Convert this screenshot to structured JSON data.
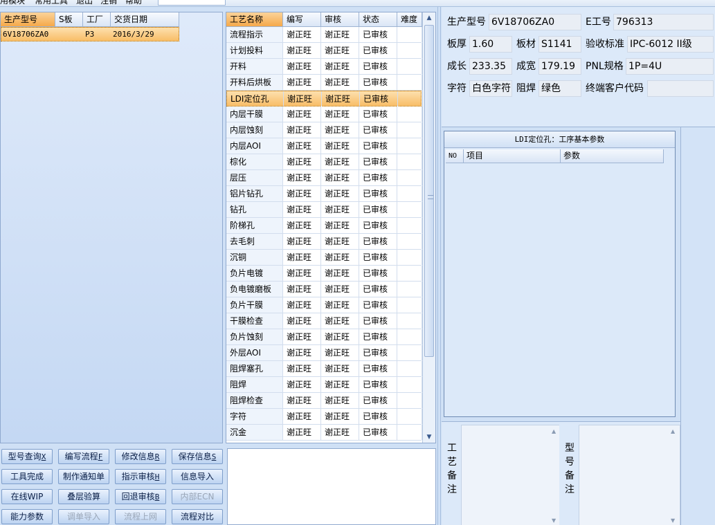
{
  "menu": [
    "用模块",
    "常用工具",
    "退出",
    "注销",
    "帮助"
  ],
  "left_grid": {
    "headers": [
      "生产型号",
      "S板",
      "工厂",
      "交货日期"
    ],
    "rows": [
      {
        "model": "6V18706ZA0",
        "s_board": "",
        "factory": "P3",
        "delivery": "2016/3/29"
      }
    ]
  },
  "process_grid": {
    "headers": [
      "工艺名称",
      "编写",
      "审核",
      "状态",
      "难度"
    ],
    "selected_index": 4,
    "rows": [
      {
        "name": "流程指示",
        "writer": "谢正旺",
        "auditor": "谢正旺",
        "status": "已审核"
      },
      {
        "name": "计划投料",
        "writer": "谢正旺",
        "auditor": "谢正旺",
        "status": "已审核"
      },
      {
        "name": "开料",
        "writer": "谢正旺",
        "auditor": "谢正旺",
        "status": "已审核"
      },
      {
        "name": "开料后烘板",
        "writer": "谢正旺",
        "auditor": "谢正旺",
        "status": "已审核"
      },
      {
        "name": "LDI定位孔",
        "writer": "谢正旺",
        "auditor": "谢正旺",
        "status": "已审核"
      },
      {
        "name": "内层干膜",
        "writer": "谢正旺",
        "auditor": "谢正旺",
        "status": "已审核"
      },
      {
        "name": "内层蚀刻",
        "writer": "谢正旺",
        "auditor": "谢正旺",
        "status": "已审核"
      },
      {
        "name": "内层AOI",
        "writer": "谢正旺",
        "auditor": "谢正旺",
        "status": "已审核"
      },
      {
        "name": "棕化",
        "writer": "谢正旺",
        "auditor": "谢正旺",
        "status": "已审核"
      },
      {
        "name": "层压",
        "writer": "谢正旺",
        "auditor": "谢正旺",
        "status": "已审核"
      },
      {
        "name": "铝片钻孔",
        "writer": "谢正旺",
        "auditor": "谢正旺",
        "status": "已审核"
      },
      {
        "name": "钻孔",
        "writer": "谢正旺",
        "auditor": "谢正旺",
        "status": "已审核"
      },
      {
        "name": "阶梯孔",
        "writer": "谢正旺",
        "auditor": "谢正旺",
        "status": "已审核"
      },
      {
        "name": "去毛刺",
        "writer": "谢正旺",
        "auditor": "谢正旺",
        "status": "已审核"
      },
      {
        "name": "沉铜",
        "writer": "谢正旺",
        "auditor": "谢正旺",
        "status": "已审核"
      },
      {
        "name": "负片电镀",
        "writer": "谢正旺",
        "auditor": "谢正旺",
        "status": "已审核"
      },
      {
        "name": "负电镀磨板",
        "writer": "谢正旺",
        "auditor": "谢正旺",
        "status": "已审核"
      },
      {
        "name": "负片干膜",
        "writer": "谢正旺",
        "auditor": "谢正旺",
        "status": "已审核"
      },
      {
        "name": "干膜检查",
        "writer": "谢正旺",
        "auditor": "谢正旺",
        "status": "已审核"
      },
      {
        "name": "负片蚀刻",
        "writer": "谢正旺",
        "auditor": "谢正旺",
        "status": "已审核"
      },
      {
        "name": "外层AOI",
        "writer": "谢正旺",
        "auditor": "谢正旺",
        "status": "已审核"
      },
      {
        "name": "阻焊塞孔",
        "writer": "谢正旺",
        "auditor": "谢正旺",
        "status": "已审核"
      },
      {
        "name": "阻焊",
        "writer": "谢正旺",
        "auditor": "谢正旺",
        "status": "已审核"
      },
      {
        "name": "阻焊检查",
        "writer": "谢正旺",
        "auditor": "谢正旺",
        "status": "已审核"
      },
      {
        "name": "字符",
        "writer": "谢正旺",
        "auditor": "谢正旺",
        "status": "已审核"
      },
      {
        "name": "沉金",
        "writer": "谢正旺",
        "auditor": "谢正旺",
        "status": "已审核"
      }
    ]
  },
  "buttons": [
    {
      "label": "型号查询",
      "key": "X",
      "enabled": true,
      "name": "model-query-button"
    },
    {
      "label": "编写流程",
      "key": "F",
      "enabled": true,
      "name": "write-flow-button"
    },
    {
      "label": "修改信息",
      "key": "R",
      "enabled": true,
      "name": "edit-info-button"
    },
    {
      "label": "保存信息",
      "key": "S",
      "enabled": true,
      "name": "save-info-button"
    },
    {
      "label": "工具完成",
      "key": "",
      "enabled": true,
      "name": "tool-complete-button"
    },
    {
      "label": "制作通知单",
      "key": "",
      "enabled": true,
      "name": "make-notice-button"
    },
    {
      "label": "指示审核",
      "key": "H",
      "enabled": true,
      "name": "instruction-audit-button"
    },
    {
      "label": "信息导入",
      "key": "",
      "enabled": true,
      "name": "info-import-button"
    },
    {
      "label": "在线WIP",
      "key": "",
      "enabled": true,
      "name": "online-wip-button"
    },
    {
      "label": "叠层验算",
      "key": "",
      "enabled": true,
      "name": "stackup-check-button"
    },
    {
      "label": "回退审核",
      "key": "B",
      "enabled": true,
      "name": "rollback-audit-button"
    },
    {
      "label": "内部ECN",
      "key": "",
      "enabled": false,
      "name": "internal-ecn-button"
    },
    {
      "label": "能力参数",
      "key": "",
      "enabled": true,
      "name": "capability-params-button"
    },
    {
      "label": "调单导入",
      "key": "",
      "enabled": false,
      "name": "order-import-button"
    },
    {
      "label": "流程上网",
      "key": "",
      "enabled": false,
      "name": "flow-online-button"
    },
    {
      "label": "流程对比",
      "key": "",
      "enabled": true,
      "name": "flow-compare-button"
    }
  ],
  "info": {
    "model_label": "生产型号",
    "model_value": "6V18706ZA0",
    "eno_label": "E工号",
    "eno_value": "796313",
    "thickness_label": "板厚",
    "thickness_value": "1.60",
    "material_label": "板材",
    "material_value": "S1141",
    "standard_label": "验收标准",
    "standard_value": "IPC-6012 II级",
    "length_label": "成长",
    "length_value": "233.35",
    "width_label": "成宽",
    "width_value": "179.19",
    "pnl_label": "PNL规格",
    "pnl_value": "1P=4U",
    "char_label": "字符",
    "char_value": "白色字符",
    "mask_label": "阻焊",
    "mask_value": "绿色",
    "endcode_label": "终端客户代码",
    "endcode_value": ""
  },
  "params": {
    "title": "LDI定位孔：工序基本参数",
    "headers": [
      "NO",
      "项目",
      "参数"
    ]
  },
  "memos": {
    "process_label": "工艺备注",
    "model_label": "型号备注"
  }
}
